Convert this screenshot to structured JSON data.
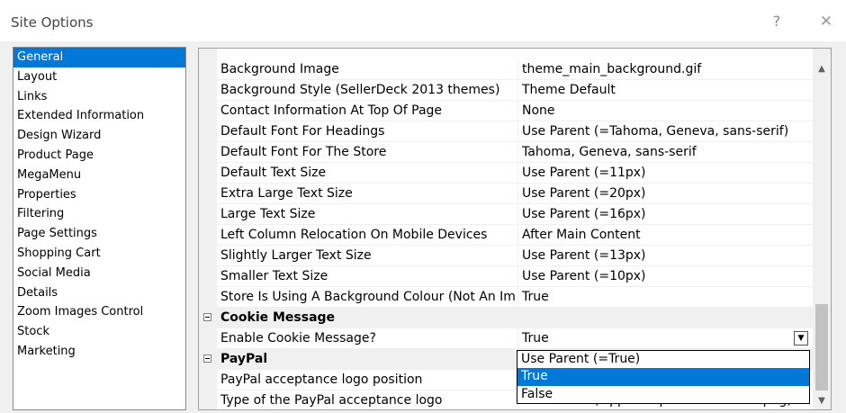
{
  "window": {
    "title": "Site Options",
    "help_label": "?",
    "close_label": "✕"
  },
  "sidebar": {
    "items": [
      {
        "label": "General",
        "selected": true
      },
      {
        "label": "Layout"
      },
      {
        "label": "Links"
      },
      {
        "label": "Extended Information"
      },
      {
        "label": "Design Wizard"
      },
      {
        "label": "Product Page"
      },
      {
        "label": "MegaMenu"
      },
      {
        "label": "Properties"
      },
      {
        "label": "Filtering"
      },
      {
        "label": "Page Settings"
      },
      {
        "label": "Shopping Cart"
      },
      {
        "label": "Social Media"
      },
      {
        "label": "Details"
      },
      {
        "label": "Zoom Images Control"
      },
      {
        "label": "Stock"
      },
      {
        "label": "Marketing"
      }
    ]
  },
  "grid": {
    "rows": [
      {
        "name": "Background Image",
        "value": "theme_main_background.gif"
      },
      {
        "name": "Background Style (SellerDeck 2013 themes)",
        "value": "Theme Default"
      },
      {
        "name": "Contact Information At Top Of Page",
        "value": "None"
      },
      {
        "name": "Default Font For Headings",
        "value": "Use Parent (=Tahoma, Geneva, sans-serif)"
      },
      {
        "name": "Default Font For The Store",
        "value": "Tahoma, Geneva, sans-serif"
      },
      {
        "name": "Default Text Size",
        "value": "Use Parent (=11px)"
      },
      {
        "name": "Extra Large Text Size",
        "value": "Use Parent (=20px)"
      },
      {
        "name": "Large Text Size",
        "value": "Use Parent (=16px)"
      },
      {
        "name": "Left Column Relocation On Mobile Devices",
        "value": "After Main Content"
      },
      {
        "name": "Slightly Larger Text Size",
        "value": "Use Parent (=13px)"
      },
      {
        "name": "Smaller Text Size",
        "value": "Use Parent (=10px)"
      },
      {
        "name": "Store Is Using A Background Colour (Not An Ima",
        "value": "True"
      }
    ],
    "cookie_category": "Cookie Message",
    "cookie_row": {
      "name": "Enable Cookie Message?",
      "value": "True",
      "dropdown_arrow": "▼"
    },
    "paypal_category": "PayPal",
    "paypal_rows": [
      {
        "name": "PayPal acceptance logo position",
        "value": ""
      },
      {
        "name": "Type of the PayPal acceptance logo",
        "value": "Use Parent (=pp-acceptance-medium.png)"
      }
    ],
    "scroll_up": "▲",
    "scroll_down": "▼"
  },
  "dropdown": {
    "options": [
      {
        "label": "Use Parent (=True)"
      },
      {
        "label": "True",
        "selected": true
      },
      {
        "label": "False"
      }
    ]
  },
  "colors": {
    "selection": "#0078d7",
    "category_bg": "#f0f0f0"
  }
}
